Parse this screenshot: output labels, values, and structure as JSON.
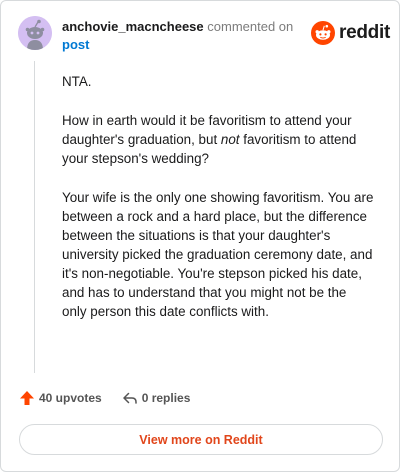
{
  "header": {
    "username": "anchovie_macncheese",
    "action_text": "commented on",
    "post_link": "post"
  },
  "brand": {
    "wordmark": "reddit",
    "logo_icon": "reddit-snoo-icon",
    "accent_color": "#ff4500"
  },
  "comment": {
    "paragraph_1": "NTA.",
    "paragraph_2_before": "How in earth would it be favoritism to attend your daughter's graduation, but ",
    "paragraph_2_emphasis": "not",
    "paragraph_2_after": " favoritism to attend your stepson's wedding?",
    "paragraph_3": "Your wife is the only one showing favoritism. You are between a rock and a hard place, but the difference between the situations is that your daughter's university picked the graduation ceremony date, and it's non-negotiable. You're stepson picked his date, and has to understand that you might not be the only person this date conflicts with."
  },
  "actions": {
    "upvotes_label": "40 upvotes",
    "upvote_icon": "upvote-arrow-icon",
    "replies_label": "0 replies",
    "reply_icon": "reply-arrow-icon"
  },
  "footer": {
    "view_more_label": "View more on Reddit"
  }
}
